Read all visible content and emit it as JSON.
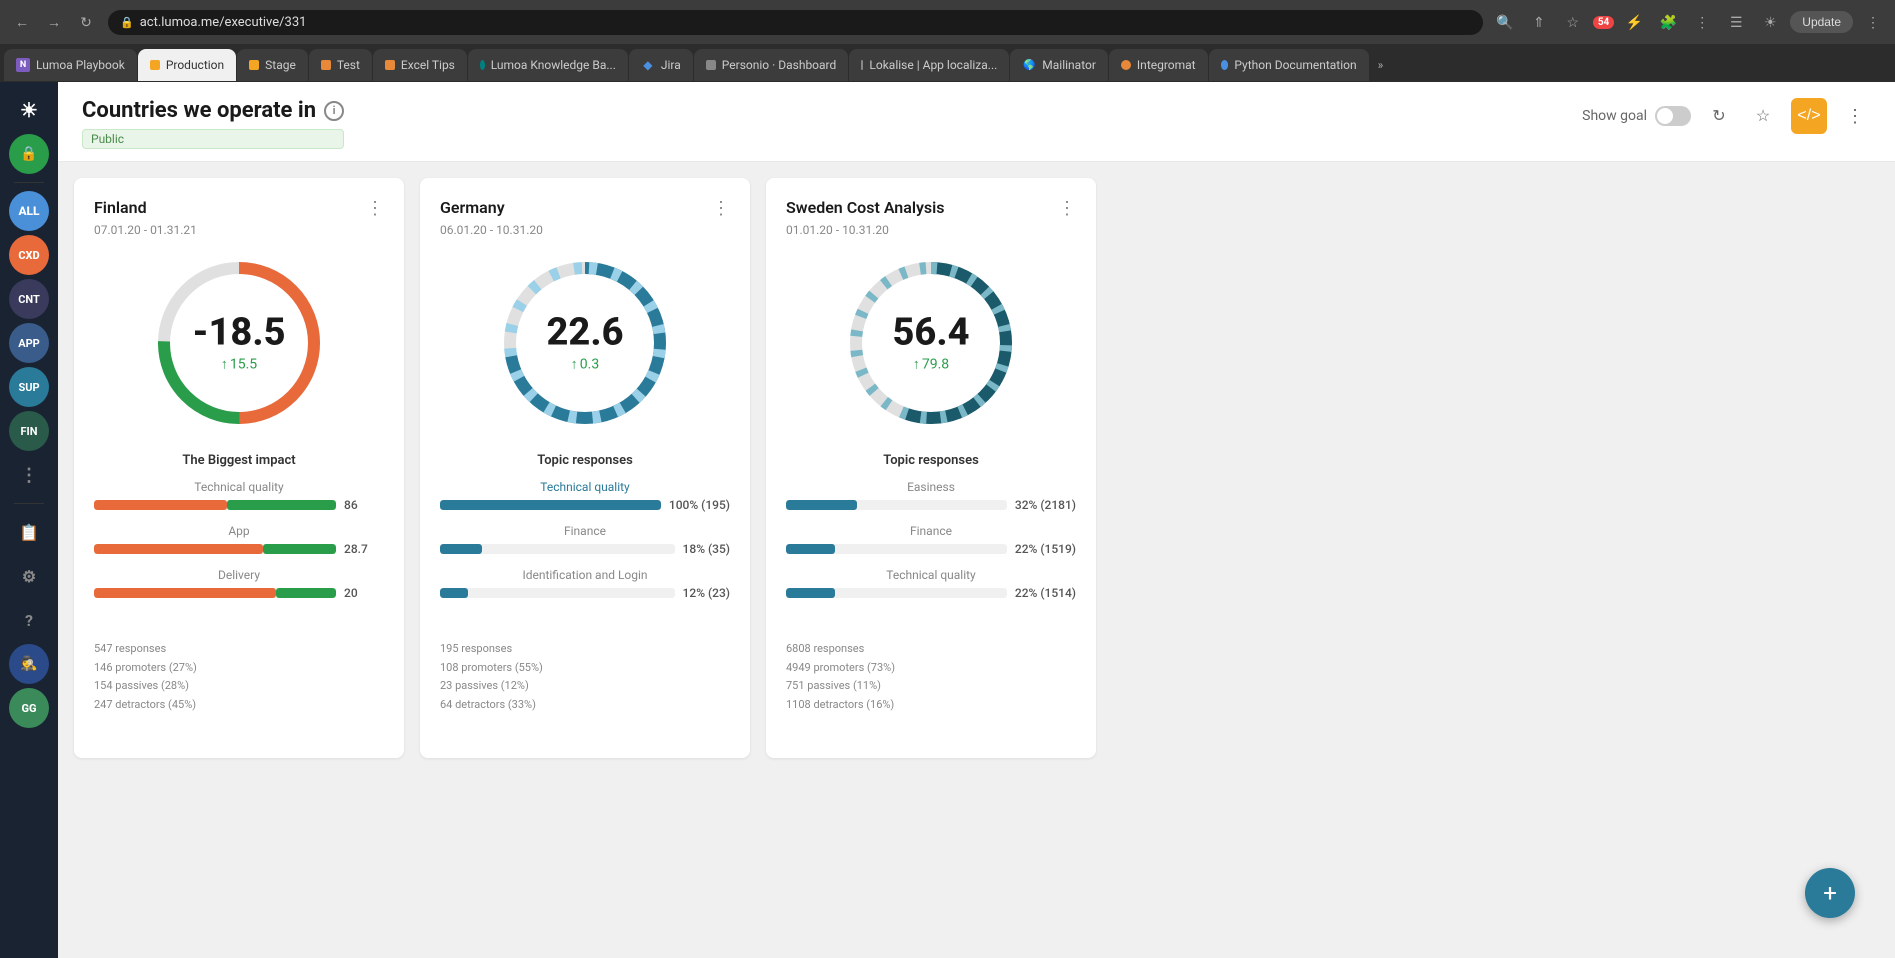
{
  "browser": {
    "url": "act.lumoa.me/executive/331",
    "update_label": "Update",
    "tabs": [
      {
        "label": "Lumoa Playbook",
        "favicon_type": "purple",
        "favicon_text": "N"
      },
      {
        "label": "Production",
        "favicon_type": "yellow",
        "active": true
      },
      {
        "label": "Stage",
        "favicon_type": "yellow"
      },
      {
        "label": "Test",
        "favicon_type": "orange"
      },
      {
        "label": "Excel Tips",
        "favicon_type": "orange"
      },
      {
        "label": "Lumoa Knowledge Ba...",
        "favicon_type": "teal"
      },
      {
        "label": "Jira",
        "favicon_type": "diamond"
      },
      {
        "label": "Personio · Dashboard",
        "favicon_type": "gray"
      },
      {
        "label": "Lokalise | App localiza...",
        "favicon_type": "gray"
      },
      {
        "label": "Mailinator",
        "favicon_type": "globe"
      },
      {
        "label": "Integromat",
        "favicon_type": "orange2"
      },
      {
        "label": "Python Documentation",
        "favicon_type": "blue"
      }
    ]
  },
  "sidebar": {
    "items": [
      {
        "id": "all",
        "label": "ALL",
        "type": "all"
      },
      {
        "id": "cxd",
        "label": "CXD",
        "type": "cxd"
      },
      {
        "id": "cnt",
        "label": "CNT",
        "type": "cnt"
      },
      {
        "id": "app",
        "label": "APP",
        "type": "app"
      },
      {
        "id": "sup",
        "label": "SUP",
        "type": "sup"
      },
      {
        "id": "fin",
        "label": "FIN",
        "type": "fin"
      },
      {
        "id": "gg",
        "label": "GG",
        "type": "gg"
      }
    ]
  },
  "page": {
    "title": "Countries we operate in",
    "visibility": "Public",
    "show_goal_label": "Show goal"
  },
  "cards": [
    {
      "id": "finland",
      "title": "Finland",
      "date_range": "07.01.20 - 01.31.21",
      "score": "-18.5",
      "trend": "↑ 15.5",
      "gauge_type": "mixed",
      "section_title": "The Biggest impact",
      "topics": [
        {
          "name": "Technical quality",
          "value": "86",
          "pct": 86,
          "bar_type": "red_green",
          "red_pct": 55,
          "green_pct": 45
        },
        {
          "name": "App",
          "value": "28.7",
          "pct": 28,
          "bar_type": "red_green",
          "red_pct": 70,
          "green_pct": 30
        },
        {
          "name": "Delivery",
          "value": "20",
          "pct": 20,
          "bar_type": "red_green",
          "red_pct": 75,
          "green_pct": 25
        }
      ],
      "stats": [
        "547 responses",
        "146 promoters (27%)",
        "154 passives (28%)",
        "247 detractors (45%)"
      ]
    },
    {
      "id": "germany",
      "title": "Germany",
      "date_range": "06.01.20 - 10.31.20",
      "score": "22.6",
      "trend": "↑ 0.3",
      "gauge_type": "teal_light",
      "section_title": "Topic responses",
      "topics": [
        {
          "name": "Technical quality",
          "value": "100% (195)",
          "pct": 100,
          "bar_type": "teal",
          "colored": true
        },
        {
          "name": "Finance",
          "value": "18% (35)",
          "pct": 18,
          "bar_type": "teal",
          "colored": false
        },
        {
          "name": "Identification and Login",
          "value": "12% (23)",
          "pct": 12,
          "bar_type": "teal",
          "colored": false
        }
      ],
      "stats": [
        "195 responses",
        "108 promoters (55%)",
        "23 passives (12%)",
        "64 detractors (33%)"
      ]
    },
    {
      "id": "sweden",
      "title": "Sweden Cost Analysis",
      "date_range": "01.01.20 - 10.31.20",
      "score": "56.4",
      "trend": "↑ 79.8",
      "gauge_type": "dark_teal",
      "section_title": "Topic responses",
      "topics": [
        {
          "name": "Easiness",
          "value": "32% (2181)",
          "pct": 32,
          "bar_type": "teal"
        },
        {
          "name": "Finance",
          "value": "22% (1519)",
          "pct": 22,
          "bar_type": "teal"
        },
        {
          "name": "Technical quality",
          "value": "22% (1514)",
          "pct": 22,
          "bar_type": "teal"
        }
      ],
      "stats": [
        "6808 responses",
        "4949 promoters (73%)",
        "751 passives (11%)",
        "1108 detractors (16%)"
      ]
    }
  ],
  "fab": {
    "icon": "+"
  }
}
